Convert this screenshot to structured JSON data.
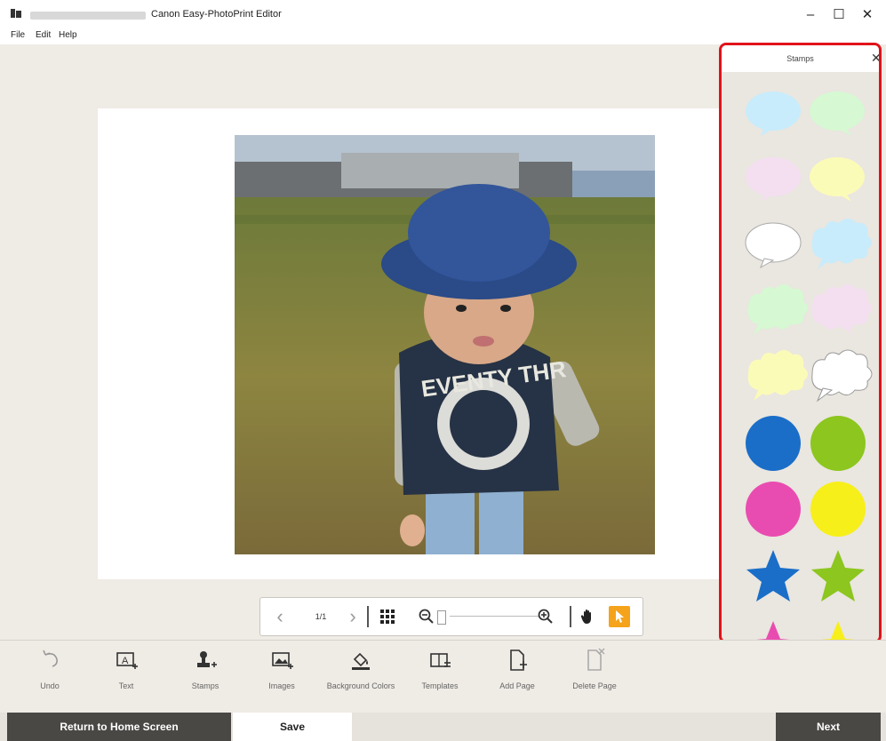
{
  "window": {
    "title": "Canon Easy-PhotoPrint Editor",
    "minimize": "–",
    "maximize": "☐",
    "close": "✕"
  },
  "menu": [
    "File",
    "Edit",
    "Help"
  ],
  "navigator": {
    "page": "1/1",
    "prev": "‹",
    "next": "›"
  },
  "stamps_panel": {
    "title": "Stamps",
    "close": "✕"
  },
  "toolbar": {
    "undo": "Undo",
    "text": "Text",
    "stamps": "Stamps",
    "images": "Images",
    "background_colors": "Background Colors",
    "templates": "Templates",
    "add_page": "Add Page",
    "delete_page": "Delete Page"
  },
  "actions": {
    "home": "Return to Home Screen",
    "save": "Save",
    "next": "Next"
  },
  "colors": {
    "accent_orange": "#f5a31a",
    "panel_border": "#e0121a",
    "dark_button": "#4a4845"
  }
}
